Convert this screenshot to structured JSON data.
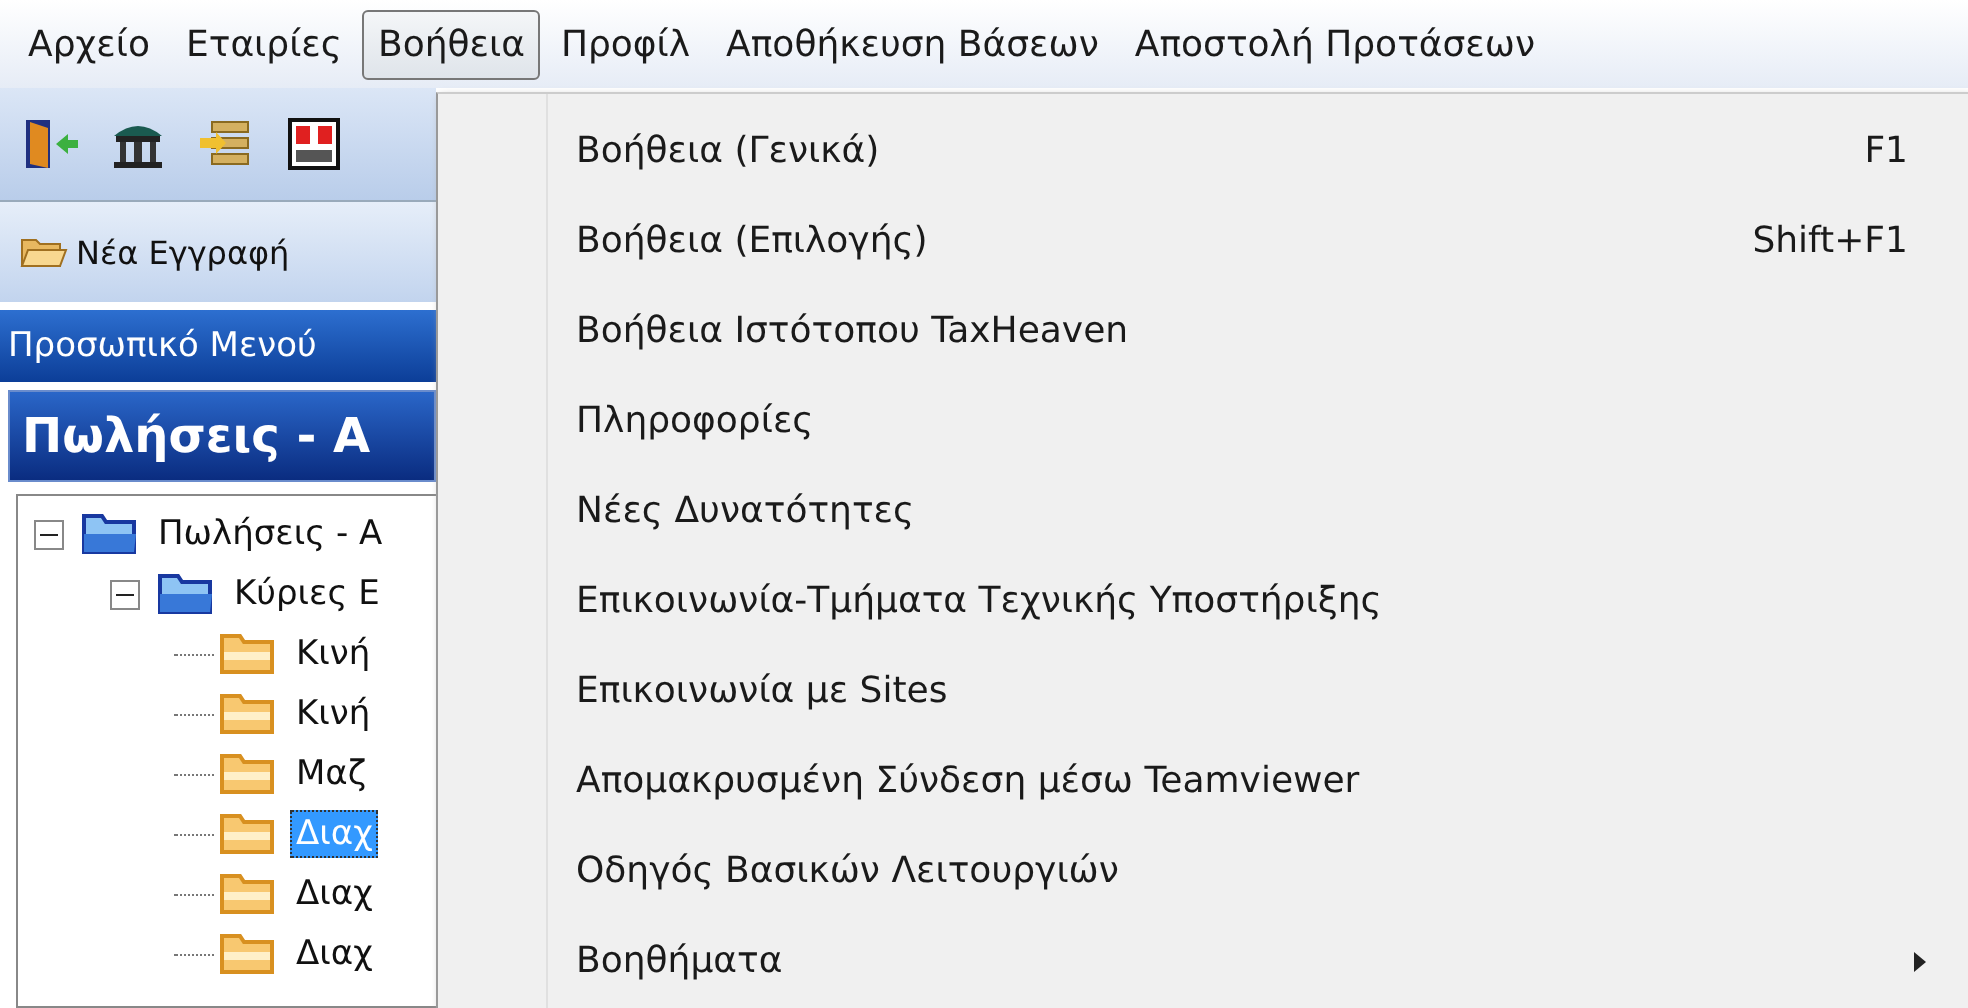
{
  "menubar": [
    {
      "label": "Αρχείο",
      "selected": false
    },
    {
      "label": "Εταιρίες",
      "selected": false
    },
    {
      "label": "Βοήθεια",
      "selected": true
    },
    {
      "label": "Προφίλ",
      "selected": false
    },
    {
      "label": "Αποθήκευση Βάσεων",
      "selected": false
    },
    {
      "label": "Αποστολή Προτάσεων",
      "selected": false
    }
  ],
  "toolbar": {
    "new_record_button": "Νέα Εγγραφή"
  },
  "personal_menu": "Προσωπικό Μενού",
  "section_title": "Πωλήσεις - Α",
  "tree": [
    {
      "label": "Πωλήσεις - Α",
      "expanded": true,
      "selected": false,
      "children": [
        {
          "label": "Κύριες Ε",
          "expanded": true,
          "selected": false,
          "children": [
            {
              "label": "Κινή",
              "selected": false
            },
            {
              "label": "Κινή",
              "selected": false
            },
            {
              "label": "Μαζ",
              "selected": false
            },
            {
              "label": "Διαχ",
              "selected": true
            },
            {
              "label": "Διαχ",
              "selected": false
            },
            {
              "label": "Διαχ",
              "selected": false
            }
          ]
        }
      ]
    }
  ],
  "help_menu": [
    {
      "label": "Βοήθεια (Γενικά)",
      "shortcut": "F1",
      "submenu": false
    },
    {
      "label": "Βοήθεια (Επιλογής)",
      "shortcut": "Shift+F1",
      "submenu": false
    },
    {
      "label": "Βοήθεια Ιστότοπου TaxHeaven",
      "submenu": false
    },
    {
      "label": "Πληροφορίες",
      "submenu": false
    },
    {
      "label": "Νέες Δυνατότητες",
      "submenu": false
    },
    {
      "label": "Επικοινωνία-Τμήματα Τεχνικής Υποστήριξης",
      "submenu": false
    },
    {
      "label": "Επικοινωνία με Sites",
      "submenu": false
    },
    {
      "label": "Απομακρυσμένη Σύνδεση μέσω Teamviewer",
      "submenu": false
    },
    {
      "label": "Οδηγός Βασικών Λειτουργιών",
      "submenu": false
    },
    {
      "label": "Βοηθήματα",
      "submenu": true
    }
  ]
}
